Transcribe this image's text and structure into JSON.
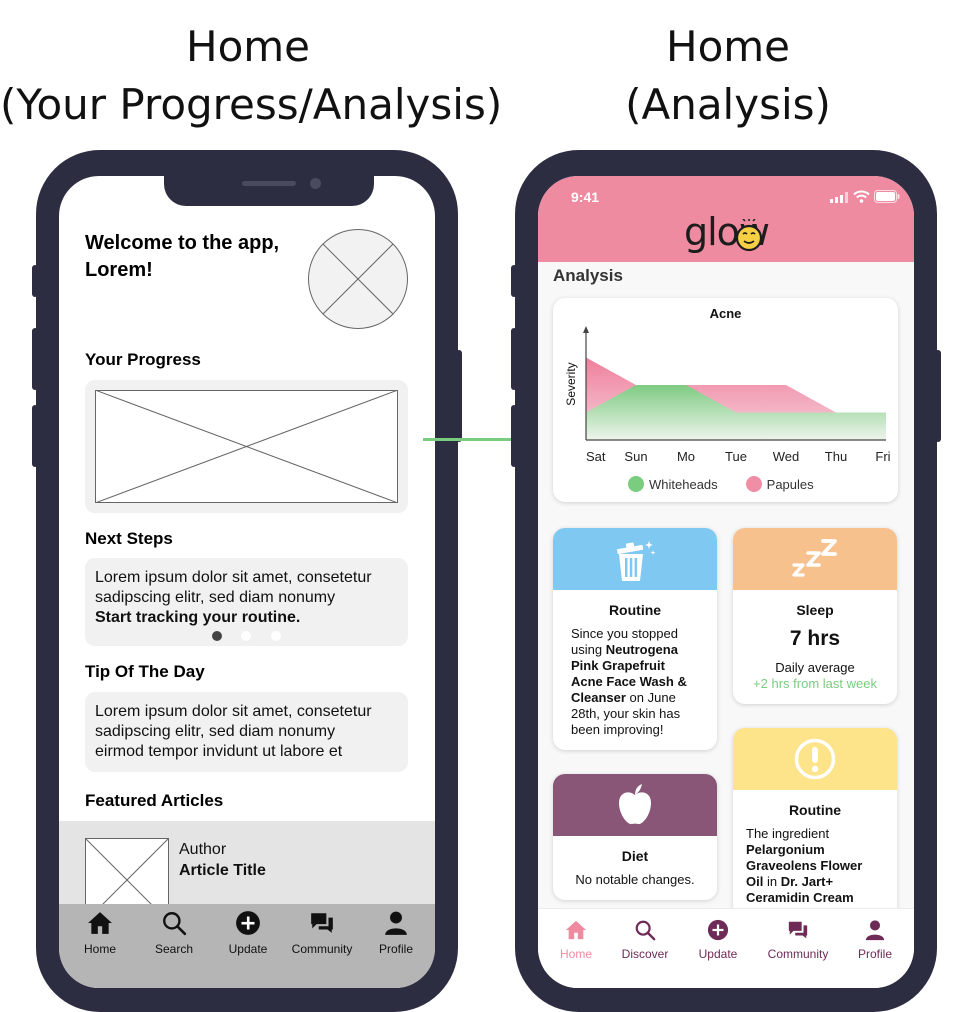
{
  "titles": {
    "left_line1": "Home",
    "left_line2": "(Your Progress/Analysis)",
    "right_line1": "Home",
    "right_line2": "(Analysis)"
  },
  "wireframe": {
    "welcome_line1": "Welcome to the app,",
    "welcome_line2": "Lorem!",
    "progress_heading": "Your Progress",
    "next_steps_heading": "Next Steps",
    "next_steps_line1": "Lorem ipsum dolor sit amet, consetetur",
    "next_steps_line2": "sadipscing elitr, sed diam nonumy",
    "next_steps_cta": "Start tracking your routine.",
    "tip_heading": "Tip Of The Day",
    "tip_line1": "Lorem ipsum dolor sit amet, consetetur",
    "tip_line2": "sadipscing elitr, sed diam nonumy",
    "tip_line3": "eirmod tempor invidunt ut labore et",
    "featured_heading": "Featured Articles",
    "article_author": "Author",
    "article_title": "Article Title",
    "tabs": [
      {
        "label": "Home",
        "icon": "home-icon"
      },
      {
        "label": "Search",
        "icon": "search-icon"
      },
      {
        "label": "Update",
        "icon": "plus-circle-icon"
      },
      {
        "label": "Community",
        "icon": "chat-icon"
      },
      {
        "label": "Profile",
        "icon": "person-icon"
      }
    ]
  },
  "glow": {
    "status_time": "9:41",
    "logo": "glow",
    "section_title": "Analysis",
    "chart_title": "Acne",
    "ylabel": "Severity",
    "legend": [
      "Whiteheads",
      "Papules"
    ],
    "cards": {
      "routine1_title": "Routine",
      "routine1_l1": "Since you stopped",
      "routine1_l2a": "using ",
      "routine1_l2b": "Neutrogena",
      "routine1_l3": "Pink Grapefruit",
      "routine1_l4": "Acne Face Wash &",
      "routine1_l5a": "Cleanser",
      "routine1_l5b": " on June",
      "routine1_l6": "28th, your skin has",
      "routine1_l7": "been improving!",
      "sleep_title": "Sleep",
      "sleep_value": "7 hrs",
      "sleep_sub": "Daily average",
      "sleep_delta": "+2 hrs from last week",
      "diet_title": "Diet",
      "diet_text": "No notable changes.",
      "routine2_title": "Routine",
      "routine2_l1": "The ingredient",
      "routine2_l2": "Pelargonium",
      "routine2_l3": "Graveolens Flower",
      "routine2_l4a": "Oil",
      "routine2_l4b": " in ",
      "routine2_l4c": "Dr. Jart+",
      "routine2_l5": "Ceramidin Cream"
    },
    "tabs": [
      {
        "label": "Home",
        "icon": "home-icon"
      },
      {
        "label": "Discover",
        "icon": "search-icon"
      },
      {
        "label": "Update",
        "icon": "plus-circle-icon"
      },
      {
        "label": "Community",
        "icon": "chat-icon"
      },
      {
        "label": "Profile",
        "icon": "person-icon"
      }
    ]
  },
  "colors": {
    "header_pink": "#ef8ba0",
    "whiteheads_green": "#7acc7f",
    "papules_pink": "#f08ea6",
    "routine_blue": "#7ec8f2",
    "sleep_orange": "#f7c18e",
    "diet_purple": "#8a5678",
    "routine_yellow": "#fde38a",
    "nav_active": "#ef8ba0",
    "nav_inactive": "#6e2b57",
    "arrow_green": "#7acc7f"
  },
  "chart_data": {
    "type": "area",
    "title": "Acne",
    "xlabel": "",
    "ylabel": "Severity",
    "categories": [
      "Sat",
      "Sun",
      "Mo",
      "Tue",
      "Wed",
      "Thu",
      "Fri"
    ],
    "ylim": [
      0,
      4
    ],
    "grid": false,
    "legend_position": "bottom",
    "series": [
      {
        "name": "Whiteheads",
        "color": "#7acc7f",
        "values": [
          1,
          2,
          2,
          1,
          1,
          1,
          1
        ]
      },
      {
        "name": "Papules",
        "color": "#f08ea6",
        "values": [
          3,
          2,
          2,
          2,
          2,
          1,
          1
        ]
      }
    ]
  }
}
